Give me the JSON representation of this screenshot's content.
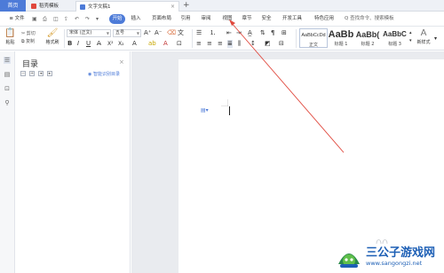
{
  "tabs": {
    "home": "首页",
    "items": [
      {
        "label": "稻壳模板",
        "icon": "docer-icon",
        "color": "#e0483d",
        "active": false
      },
      {
        "label": "文字文稿1",
        "icon": "writer-doc-icon",
        "color": "#4d7bd8",
        "active": true
      }
    ],
    "close": "×",
    "plus": "+"
  },
  "menu": {
    "file": "≡ 文件",
    "items": [
      "开始",
      "插入",
      "页面布局",
      "引用",
      "审阅",
      "视图",
      "章节",
      "安全",
      "开发工具",
      "特色应用"
    ],
    "search": "Q 查找命令、搜索模板"
  },
  "ribbon": {
    "paste": "粘贴",
    "cut": "剪切",
    "copy": "复制",
    "format_painter": "格式刷",
    "font_name": "宋体 (正文)",
    "font_size": "五号",
    "bold": "B",
    "italic": "I",
    "underline": "U",
    "styles": [
      {
        "sample": "AaBbCcDd",
        "name": "正文"
      },
      {
        "sample": "AaBb",
        "name": "标题 1"
      },
      {
        "sample": "AaBb(",
        "name": "标题 2"
      },
      {
        "sample": "AaBbC",
        "name": "标题 3"
      }
    ],
    "new_style": "新样式"
  },
  "toc": {
    "title": "目录",
    "close": "×",
    "smart": "智能识别目录"
  },
  "watermark": {
    "name": "三公子游戏网",
    "url": "www.sangongzi.net"
  },
  "colors": {
    "accent": "#4d7bd8",
    "arrow": "#e0483d",
    "watermark": "#1d5fb5"
  }
}
